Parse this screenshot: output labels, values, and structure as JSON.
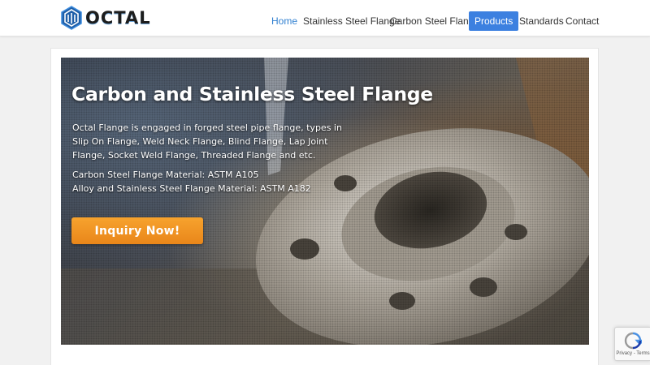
{
  "brand": {
    "name": "OCTAL"
  },
  "nav": {
    "items": [
      {
        "label": "Home",
        "state": "active"
      },
      {
        "label": "Stainless Steel Flange"
      },
      {
        "label": "Carbon Steel Flange"
      },
      {
        "label": "Products",
        "state": "highlighted"
      },
      {
        "label": "Standards"
      },
      {
        "label": "Contact"
      }
    ]
  },
  "hero": {
    "title": "Carbon and Stainless Steel Flange",
    "description": "Octal Flange is engaged in forged steel pipe flange, types in Slip On Flange, Weld Neck Flange, Blind Flange, Lap Joint Flange, Socket Weld Flange, Threaded Flange and etc.",
    "material_carbon": "Carbon Steel Flange Material: ASTM A105",
    "material_alloy": "Alloy and Stainless Steel Flange Material: ASTM A182",
    "cta_label": "Inquiry Now!",
    "image": "steel-flange-photo"
  },
  "recaptcha": {
    "text": "Privacy - Terms",
    "icon": "recaptcha-icon"
  },
  "colors": {
    "accent": "#2f7fd0",
    "nav_pill": "#3c80e0",
    "cta": "#f39a26",
    "page_bg": "#f1f1f1"
  }
}
